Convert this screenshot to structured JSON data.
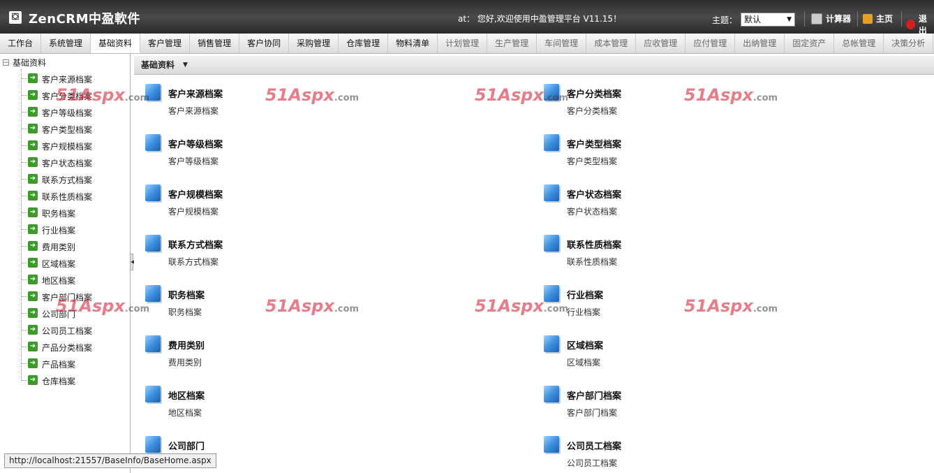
{
  "header": {
    "app_title": "ZenCRM中盈軟件",
    "welcome": "at： 您好,欢迎使用中盈管理平台 V11.15！",
    "theme_label": "主题：",
    "theme_value": "默认",
    "tools": {
      "calculator": "计算器",
      "home": "主页",
      "logout": "退出"
    }
  },
  "menu": [
    "工作台",
    "系统管理",
    "基础资料",
    "客户管理",
    "销售管理",
    "客户协同",
    "采购管理",
    "仓库管理",
    "物料清单",
    "计划管理",
    "生产管理",
    "车间管理",
    "成本管理",
    "应收管理",
    "应付管理",
    "出纳管理",
    "固定资产",
    "总帐管理",
    "决策分析"
  ],
  "sidebar": {
    "root": "基础资料",
    "items": [
      "客户来源档案",
      "客户分类档案",
      "客户等级档案",
      "客户类型档案",
      "客户规模档案",
      "客户状态档案",
      "联系方式档案",
      "联系性质档案",
      "职务档案",
      "行业档案",
      "费用类别",
      "区域档案",
      "地区档案",
      "客户部门档案",
      "公司部门",
      "公司员工档案",
      "产品分类档案",
      "产品档案",
      "仓库档案"
    ]
  },
  "panel": {
    "title": "基础资料",
    "cards": [
      {
        "title": "客户来源档案",
        "sub": "客户来源档案"
      },
      {
        "title": "客户分类档案",
        "sub": "客户分类档案"
      },
      {
        "title": "客户等级档案",
        "sub": "客户等级档案"
      },
      {
        "title": "客户类型档案",
        "sub": "客户类型档案"
      },
      {
        "title": "客户规模档案",
        "sub": "客户规模档案"
      },
      {
        "title": "客户状态档案",
        "sub": "客户状态档案"
      },
      {
        "title": "联系方式档案",
        "sub": "联系方式档案"
      },
      {
        "title": "联系性质档案",
        "sub": "联系性质档案"
      },
      {
        "title": "职务档案",
        "sub": "职务档案"
      },
      {
        "title": "行业档案",
        "sub": "行业档案"
      },
      {
        "title": "费用类别",
        "sub": "费用类别"
      },
      {
        "title": "区域档案",
        "sub": "区域档案"
      },
      {
        "title": "地区档案",
        "sub": "地区档案"
      },
      {
        "title": "客户部门档案",
        "sub": "客户部门档案"
      },
      {
        "title": "公司部门",
        "sub": ""
      },
      {
        "title": "公司员工档案",
        "sub": "公司员工档案"
      }
    ]
  },
  "watermark": {
    "main": "51Aspx",
    "suffix": ".com"
  },
  "status_url": "http://localhost:21557/BaseInfo/BaseHome.aspx",
  "colors": {
    "header_bg": "#3a3a3a",
    "tree_icon": "#3a9a2a",
    "cube": "#3d8fe0",
    "watermark": "#d2283c"
  }
}
